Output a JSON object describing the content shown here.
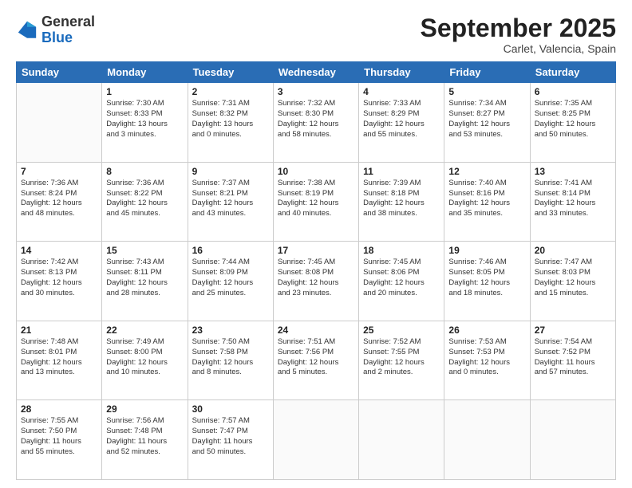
{
  "logo": {
    "general": "General",
    "blue": "Blue"
  },
  "title": "September 2025",
  "subtitle": "Carlet, Valencia, Spain",
  "days_of_week": [
    "Sunday",
    "Monday",
    "Tuesday",
    "Wednesday",
    "Thursday",
    "Friday",
    "Saturday"
  ],
  "weeks": [
    [
      {
        "day": "",
        "info": ""
      },
      {
        "day": "1",
        "info": "Sunrise: 7:30 AM\nSunset: 8:33 PM\nDaylight: 13 hours\nand 3 minutes."
      },
      {
        "day": "2",
        "info": "Sunrise: 7:31 AM\nSunset: 8:32 PM\nDaylight: 13 hours\nand 0 minutes."
      },
      {
        "day": "3",
        "info": "Sunrise: 7:32 AM\nSunset: 8:30 PM\nDaylight: 12 hours\nand 58 minutes."
      },
      {
        "day": "4",
        "info": "Sunrise: 7:33 AM\nSunset: 8:29 PM\nDaylight: 12 hours\nand 55 minutes."
      },
      {
        "day": "5",
        "info": "Sunrise: 7:34 AM\nSunset: 8:27 PM\nDaylight: 12 hours\nand 53 minutes."
      },
      {
        "day": "6",
        "info": "Sunrise: 7:35 AM\nSunset: 8:25 PM\nDaylight: 12 hours\nand 50 minutes."
      }
    ],
    [
      {
        "day": "7",
        "info": "Sunrise: 7:36 AM\nSunset: 8:24 PM\nDaylight: 12 hours\nand 48 minutes."
      },
      {
        "day": "8",
        "info": "Sunrise: 7:36 AM\nSunset: 8:22 PM\nDaylight: 12 hours\nand 45 minutes."
      },
      {
        "day": "9",
        "info": "Sunrise: 7:37 AM\nSunset: 8:21 PM\nDaylight: 12 hours\nand 43 minutes."
      },
      {
        "day": "10",
        "info": "Sunrise: 7:38 AM\nSunset: 8:19 PM\nDaylight: 12 hours\nand 40 minutes."
      },
      {
        "day": "11",
        "info": "Sunrise: 7:39 AM\nSunset: 8:18 PM\nDaylight: 12 hours\nand 38 minutes."
      },
      {
        "day": "12",
        "info": "Sunrise: 7:40 AM\nSunset: 8:16 PM\nDaylight: 12 hours\nand 35 minutes."
      },
      {
        "day": "13",
        "info": "Sunrise: 7:41 AM\nSunset: 8:14 PM\nDaylight: 12 hours\nand 33 minutes."
      }
    ],
    [
      {
        "day": "14",
        "info": "Sunrise: 7:42 AM\nSunset: 8:13 PM\nDaylight: 12 hours\nand 30 minutes."
      },
      {
        "day": "15",
        "info": "Sunrise: 7:43 AM\nSunset: 8:11 PM\nDaylight: 12 hours\nand 28 minutes."
      },
      {
        "day": "16",
        "info": "Sunrise: 7:44 AM\nSunset: 8:09 PM\nDaylight: 12 hours\nand 25 minutes."
      },
      {
        "day": "17",
        "info": "Sunrise: 7:45 AM\nSunset: 8:08 PM\nDaylight: 12 hours\nand 23 minutes."
      },
      {
        "day": "18",
        "info": "Sunrise: 7:45 AM\nSunset: 8:06 PM\nDaylight: 12 hours\nand 20 minutes."
      },
      {
        "day": "19",
        "info": "Sunrise: 7:46 AM\nSunset: 8:05 PM\nDaylight: 12 hours\nand 18 minutes."
      },
      {
        "day": "20",
        "info": "Sunrise: 7:47 AM\nSunset: 8:03 PM\nDaylight: 12 hours\nand 15 minutes."
      }
    ],
    [
      {
        "day": "21",
        "info": "Sunrise: 7:48 AM\nSunset: 8:01 PM\nDaylight: 12 hours\nand 13 minutes."
      },
      {
        "day": "22",
        "info": "Sunrise: 7:49 AM\nSunset: 8:00 PM\nDaylight: 12 hours\nand 10 minutes."
      },
      {
        "day": "23",
        "info": "Sunrise: 7:50 AM\nSunset: 7:58 PM\nDaylight: 12 hours\nand 8 minutes."
      },
      {
        "day": "24",
        "info": "Sunrise: 7:51 AM\nSunset: 7:56 PM\nDaylight: 12 hours\nand 5 minutes."
      },
      {
        "day": "25",
        "info": "Sunrise: 7:52 AM\nSunset: 7:55 PM\nDaylight: 12 hours\nand 2 minutes."
      },
      {
        "day": "26",
        "info": "Sunrise: 7:53 AM\nSunset: 7:53 PM\nDaylight: 12 hours\nand 0 minutes."
      },
      {
        "day": "27",
        "info": "Sunrise: 7:54 AM\nSunset: 7:52 PM\nDaylight: 11 hours\nand 57 minutes."
      }
    ],
    [
      {
        "day": "28",
        "info": "Sunrise: 7:55 AM\nSunset: 7:50 PM\nDaylight: 11 hours\nand 55 minutes."
      },
      {
        "day": "29",
        "info": "Sunrise: 7:56 AM\nSunset: 7:48 PM\nDaylight: 11 hours\nand 52 minutes."
      },
      {
        "day": "30",
        "info": "Sunrise: 7:57 AM\nSunset: 7:47 PM\nDaylight: 11 hours\nand 50 minutes."
      },
      {
        "day": "",
        "info": ""
      },
      {
        "day": "",
        "info": ""
      },
      {
        "day": "",
        "info": ""
      },
      {
        "day": "",
        "info": ""
      }
    ]
  ]
}
